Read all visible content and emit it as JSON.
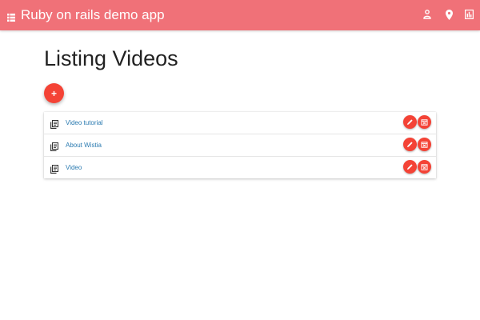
{
  "appbar": {
    "title": "Ruby on rails demo app",
    "menu_icon": "grid-menu-icon",
    "actions": [
      {
        "icon": "user-icon"
      },
      {
        "icon": "location-pin-icon"
      },
      {
        "icon": "bar-chart-icon"
      }
    ],
    "color": "#f07178"
  },
  "main": {
    "heading": "Listing Videos",
    "add_button_label": "+",
    "accent": "#f44336",
    "link_color": "#2a7ab0"
  },
  "videos": [
    {
      "title": "Video tutorial"
    },
    {
      "title": "About Wistia"
    },
    {
      "title": "Video"
    }
  ]
}
